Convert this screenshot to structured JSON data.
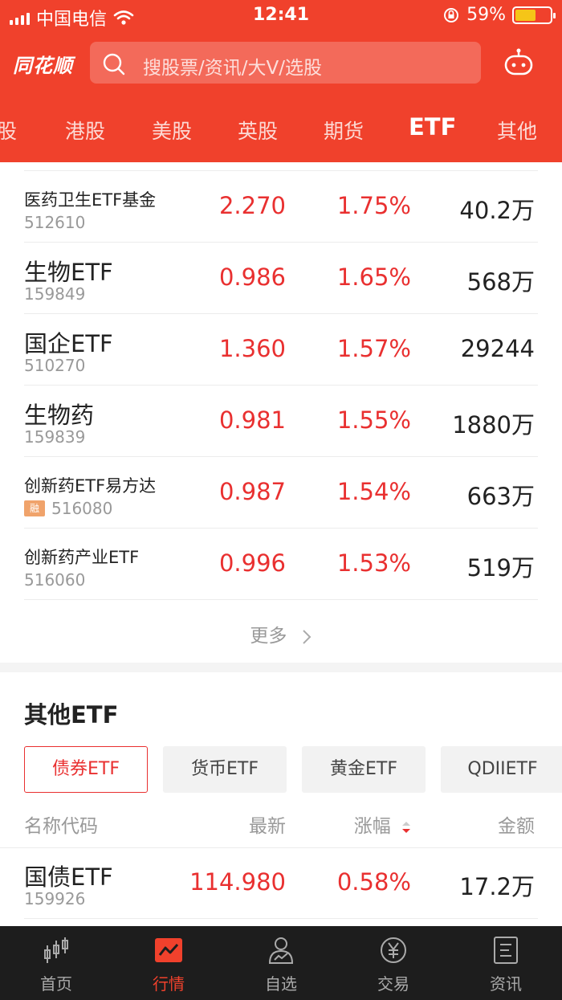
{
  "status_bar": {
    "carrier": "中国电信",
    "time": "12:41",
    "battery_pct": "59%",
    "battery_level": 0.59
  },
  "header": {
    "logo": "同花顺",
    "search_placeholder": "搜股票/资讯/大V/选股"
  },
  "tabs": [
    {
      "label": "股"
    },
    {
      "label": "港股"
    },
    {
      "label": "美股"
    },
    {
      "label": "英股"
    },
    {
      "label": "期货"
    },
    {
      "label": "ETF"
    },
    {
      "label": "其他"
    }
  ],
  "etf_list": [
    {
      "name": "医药卫生ETF基金",
      "code": "512610",
      "price": "2.270",
      "change": "1.75%",
      "amount": "40.2万"
    },
    {
      "name": "生物ETF",
      "code": "159849",
      "price": "0.986",
      "change": "1.65%",
      "amount": "568万"
    },
    {
      "name": "国企ETF",
      "code": "510270",
      "price": "1.360",
      "change": "1.57%",
      "amount": "29244"
    },
    {
      "name": "生物药",
      "code": "159839",
      "price": "0.981",
      "change": "1.55%",
      "amount": "1880万"
    },
    {
      "name": "创新药ETF易方达",
      "code": "516080",
      "price": "0.987",
      "change": "1.54%",
      "amount": "663万",
      "badge": "融"
    },
    {
      "name": "创新药产业ETF",
      "code": "516060",
      "price": "0.996",
      "change": "1.53%",
      "amount": "519万"
    }
  ],
  "more_label": "更多",
  "other_section": {
    "title": "其他ETF",
    "subtabs": [
      {
        "label": "债券ETF"
      },
      {
        "label": "货币ETF"
      },
      {
        "label": "黄金ETF"
      },
      {
        "label": "QDIIETF"
      }
    ],
    "columns": {
      "name": "名称代码",
      "price": "最新",
      "change": "涨幅",
      "amount": "金额"
    },
    "rows": [
      {
        "name": "国债ETF",
        "code": "159926",
        "price": "114.980",
        "change": "0.58%",
        "amount": "17.2万"
      }
    ]
  },
  "bottom_nav": [
    {
      "label": "首页",
      "icon": "candlestick-icon"
    },
    {
      "label": "行情",
      "icon": "market-chart-icon"
    },
    {
      "label": "自选",
      "icon": "person-chart-icon"
    },
    {
      "label": "交易",
      "icon": "yuan-icon"
    },
    {
      "label": "资讯",
      "icon": "news-icon"
    }
  ],
  "colors": {
    "brand": "#f0412c",
    "up": "#e93030",
    "nav_bg": "#1d1d1d"
  }
}
